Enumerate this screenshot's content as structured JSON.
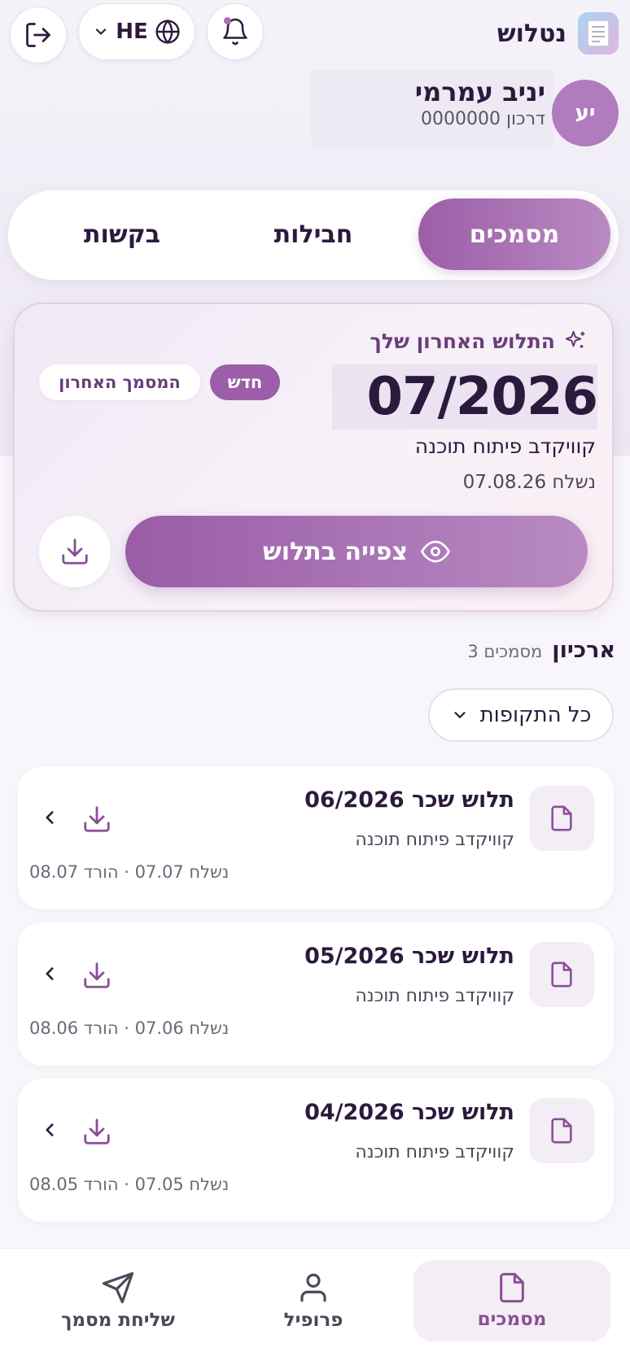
{
  "header": {
    "brand_name": "נטלוש",
    "language": "HE",
    "icons": {
      "brand": "document-logo-icon",
      "bell": "bell-icon",
      "globe": "globe-icon",
      "chevron": "chevron-down-icon",
      "logout": "logout-icon"
    }
  },
  "user": {
    "initials": "יע",
    "name": "יניב עמרמי",
    "passport": "דרכון 0000000"
  },
  "tabs": [
    {
      "label": "מסמכים",
      "active": true
    },
    {
      "label": "חבילות",
      "active": false
    },
    {
      "label": "בקשות",
      "active": false
    }
  ],
  "latest": {
    "title": "התלוש האחרון שלך",
    "period": "07/2026",
    "company": "קוויקדב פיתוח תוכנה",
    "sent": "נשלח 07.08.26",
    "badge_new": "חדש",
    "badge_last": "המסמך האחרון",
    "view_label": "צפייה בתלוש"
  },
  "archive": {
    "title": "ארכיון",
    "count": "3 מסמכים",
    "filter_label": "כל התקופות",
    "items": [
      {
        "title": "תלוש שכר  06/2026",
        "company": "קוויקדב פיתוח תוכנה",
        "meta": "נשלח 07.07 · הורד 08.07"
      },
      {
        "title": "תלוש שכר  05/2026",
        "company": "קוויקדב פיתוח תוכנה",
        "meta": "נשלח 07.06 · הורד 08.06"
      },
      {
        "title": "תלוש שכר  04/2026",
        "company": "קוויקדב פיתוח תוכנה",
        "meta": "נשלח 07.05 · הורד 08.05"
      }
    ]
  },
  "bottom_nav": [
    {
      "label": "מסמכים",
      "icon": "document-icon",
      "active": true
    },
    {
      "label": "פרופיל",
      "icon": "user-icon",
      "active": false
    },
    {
      "label": "שליחת מסמך",
      "icon": "send-icon",
      "active": false
    }
  ],
  "colors": {
    "accent": "#9c5ea8",
    "accent_light": "#b98ac2",
    "text": "#2b1a3d",
    "muted": "#6e6878"
  }
}
